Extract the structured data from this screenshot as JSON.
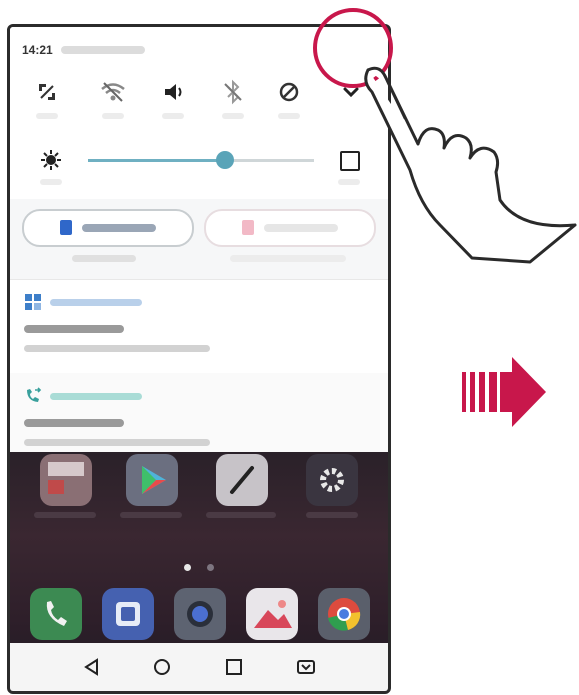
{
  "status": {
    "time": "14:21"
  },
  "quick_settings": [
    "screen-rotation-icon",
    "wifi-off-icon",
    "sound-icon",
    "bluetooth-off-icon",
    "do-not-disturb-icon"
  ],
  "brightness": {
    "level": 0.62
  },
  "colors": {
    "accent": "#5aa4b8",
    "highlight_circle": "#c8174b",
    "arrow": "#c8174b",
    "nav_bar": "#f5f5f5"
  },
  "home_apps": [
    "sim-toolkit-icon",
    "play-store-icon",
    "pen-icon",
    "settings-icon"
  ],
  "dock_apps": [
    "phone-icon",
    "messages-icon",
    "camera-icon",
    "gallery-icon",
    "chrome-icon"
  ],
  "nav": [
    "back-icon",
    "home-icon",
    "recents-icon",
    "dual-window-icon"
  ]
}
